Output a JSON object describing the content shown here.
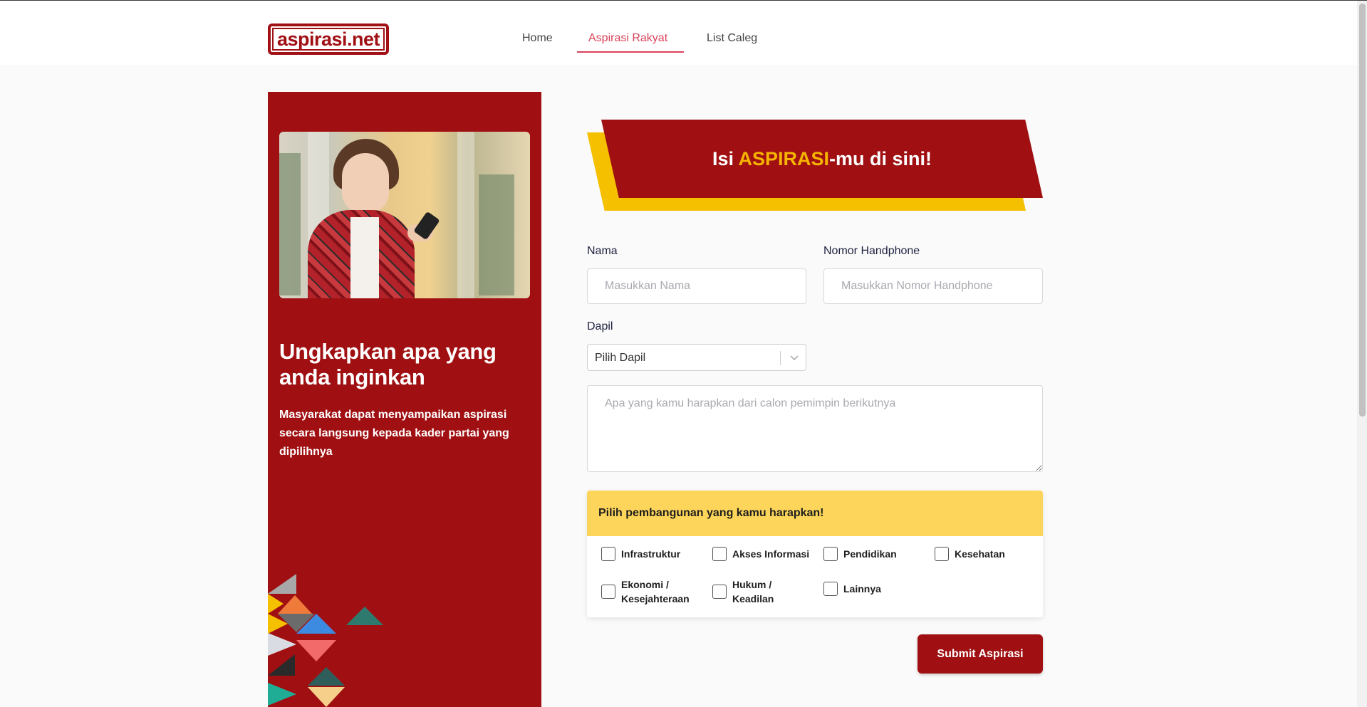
{
  "brand": {
    "logo_text": "aspirasi.net",
    "accent": "#a01012",
    "yellow": "#f5c000"
  },
  "nav": {
    "items": [
      {
        "label": "Home"
      },
      {
        "label": "Aspirasi Rakyat",
        "active": true
      },
      {
        "label": "List Caleg"
      }
    ]
  },
  "left_panel": {
    "title": "Ungkapkan apa yang anda inginkan",
    "description": "Masyarakat dapat menyampaikan aspirasi secara langsung kepada kader partai yang dipilihnya"
  },
  "banner": {
    "prefix": "Isi ",
    "highlight": "ASPIRASI",
    "suffix": "-mu di sini!"
  },
  "form": {
    "nama_label": "Nama",
    "nama_placeholder": "Masukkan Nama",
    "hp_label": "Nomor Handphone",
    "hp_placeholder": "Masukkan Nomor Handphone",
    "dapil_label": "Dapil",
    "dapil_value": "Pilih Dapil",
    "aspirasi_placeholder": "Apa yang kamu harapkan dari calon pemimpin berikutnya"
  },
  "pembangunan": {
    "title": "Pilih pembangunan yang kamu harapkan!",
    "options": [
      {
        "label": "Infrastruktur",
        "checked": false
      },
      {
        "label": "Akses Informasi",
        "checked": false
      },
      {
        "label": "Pendidikan",
        "checked": false
      },
      {
        "label": "Kesehatan",
        "checked": false
      },
      {
        "label": "Ekonomi / Kesejahteraan",
        "checked": false
      },
      {
        "label": "Hukum / Keadilan",
        "checked": false
      },
      {
        "label": "Lainnya",
        "checked": false
      }
    ]
  },
  "submit_label": "Submit Aspirasi"
}
